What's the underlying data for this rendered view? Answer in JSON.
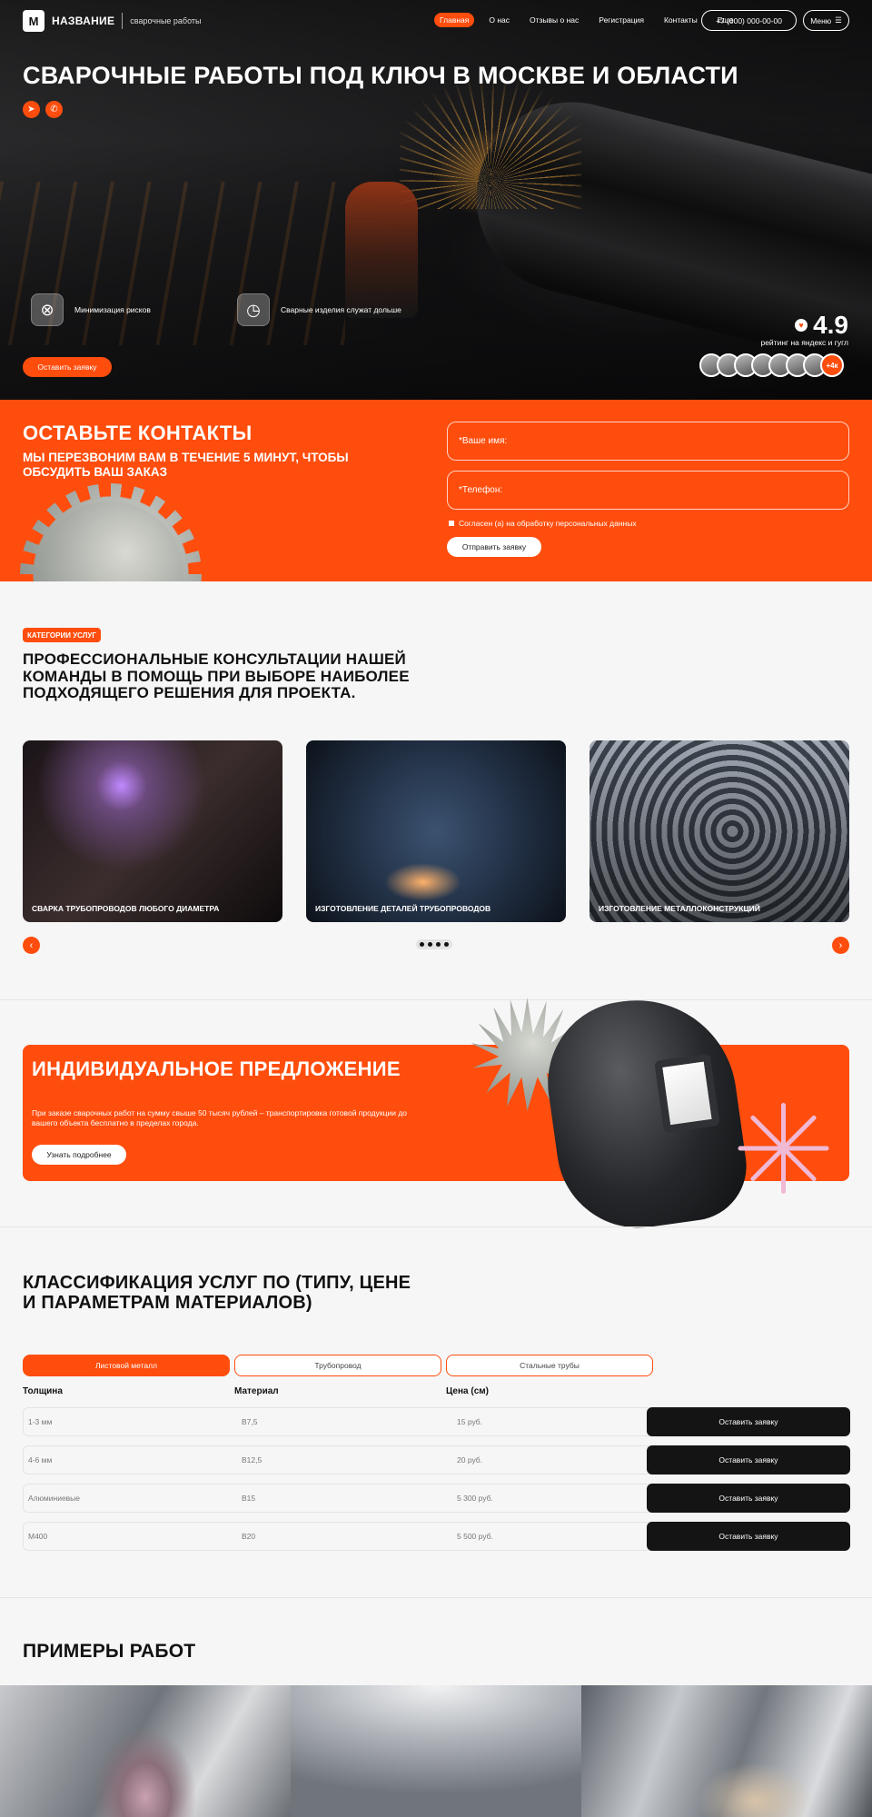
{
  "header": {
    "logo_mark": "M",
    "brand_name": "НАЗВАНИЕ",
    "brand_subtitle": "сварочные работы",
    "nav": [
      "Главная",
      "О нас",
      "Отзывы о нас",
      "Регистрация",
      "Контакты",
      "Еще"
    ],
    "phone": "+7 (000) 000-00-00",
    "menu_label": "Меню"
  },
  "hero": {
    "title": "СВАРОЧНЫЕ РАБОТЫ ПОД КЛЮЧ В МОСКВЕ И ОБЛАСТИ",
    "features": [
      "Минимизация рисков",
      "Сварные изделия служат дольше"
    ],
    "rating_value": "4.9",
    "rating_caption": "рейтинг на яндекс и гугл",
    "avatars_more": "+4к",
    "cta": "Оставить заявку"
  },
  "contact": {
    "title": "ОСТАВЬТЕ КОНТАКТЫ",
    "subtitle": "МЫ ПЕРЕЗВОНИМ ВАМ В ТЕЧЕНИЕ 5 МИНУТ, ЧТОБЫ ОБСУДИТЬ ВАШ ЗАКАЗ",
    "name_placeholder": "*Ваше имя:",
    "phone_placeholder": "*Телефон:",
    "consent": "Согласен (а) на обработку персональных данных",
    "submit": "Отправить заявку"
  },
  "categories": {
    "badge": "КАТЕГОРИИ УСЛУГ",
    "title": "ПРОФЕССИОНАЛЬНЫЕ КОНСУЛЬТАЦИИ НАШЕЙ КОМАНДЫ В ПОМОЩЬ ПРИ ВЫБОРЕ НАИБОЛЕЕ ПОДХОДЯЩЕГО РЕШЕНИЯ ДЛЯ ПРОЕКТА.",
    "cards": [
      "СВАРКА ТРУБОПРОВОДОВ ЛЮБОГО ДИАМЕТРА",
      "ИЗГОТОВЛЕНИЕ ДЕТАЛЕЙ ТРУБОПРОВОДОВ",
      "ИЗГОТОВЛЕНИЕ МЕТАЛЛОКОНСТРУКЦИЙ"
    ]
  },
  "promo": {
    "title": "ИНДИВИДУАЛЬНОЕ ПРЕДЛОЖЕНИЕ",
    "text": "При заказе сварочных работ на сумму свыше 50 тысяч рублей – транспортировка готовой продукции до вашего объекта бесплатно в пределах города.",
    "button": "Узнать подробнее"
  },
  "classification": {
    "title": "КЛАССИФИКАЦИЯ УСЛУГ ПО (ТИПУ, ЦЕНЕ И ПАРАМЕТРАМ МАТЕРИАЛОВ)",
    "tabs": [
      "Листовой металл",
      "Трубопровод",
      "Стальные трубы"
    ],
    "columns": [
      "Толщина",
      "Материал",
      "Цена (см)"
    ],
    "rows": [
      [
        "1-3 мм",
        "В7,5",
        "15 руб."
      ],
      [
        "4-6 мм",
        "В12,5",
        "20 руб."
      ],
      [
        "Алюминиевые",
        "В15",
        "5 300 руб."
      ],
      [
        "М400",
        "В20",
        "5 500 руб."
      ]
    ],
    "row_button": "Оставить заявку"
  },
  "examples": {
    "title": "ПРИМЕРЫ РАБОТ"
  },
  "colors": {
    "accent": "#ff4d0d",
    "dark": "#141414",
    "background": "#f6f6f6"
  }
}
